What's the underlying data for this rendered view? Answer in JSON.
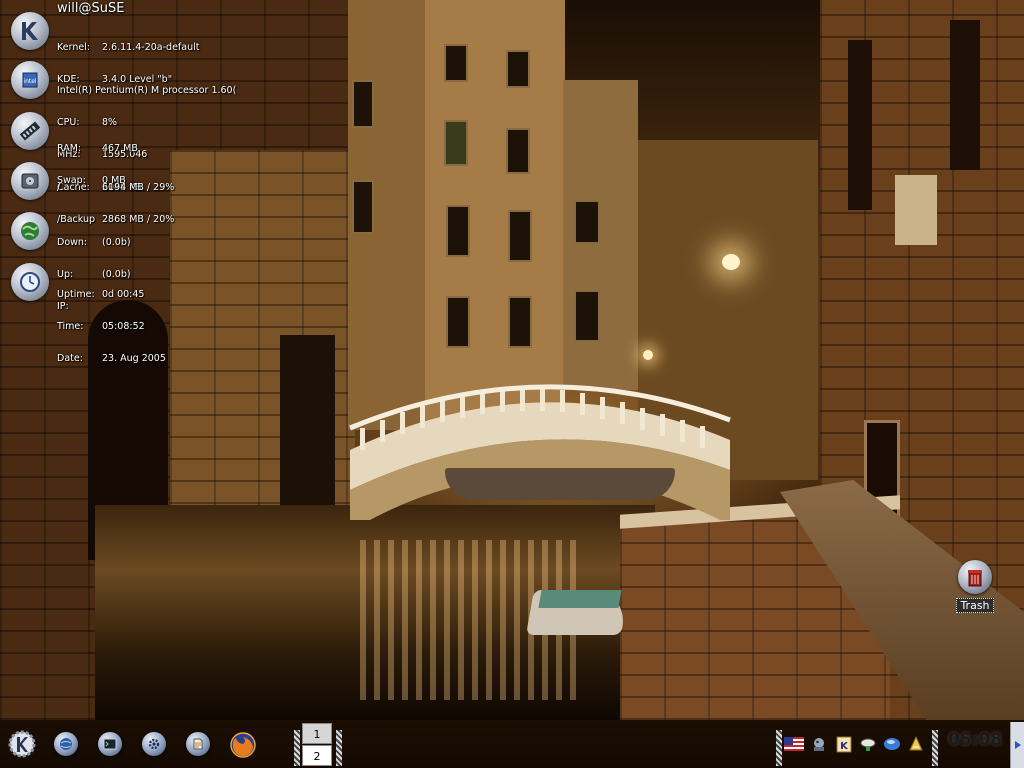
{
  "monitor": {
    "user_host": "will@SuSE",
    "system": [
      {
        "label": "Kernel:",
        "value": "2.6.11.4-20a-default"
      },
      {
        "label": "KDE:",
        "value": "3.4.0 Level \"b\""
      }
    ],
    "cpu": [
      {
        "label": "",
        "value": "Intel(R) Pentium(R) M processor 1.60("
      },
      {
        "label": "CPU:",
        "value": "8%"
      },
      {
        "label": "MHz:",
        "value": "1595.046"
      },
      {
        "label": "Cache:",
        "value": "2048 KB"
      }
    ],
    "memory": [
      {
        "label": "RAM:",
        "value": "467 MB"
      },
      {
        "label": "Swap:",
        "value": "0 MB"
      }
    ],
    "disk": [
      {
        "label": "/",
        "value": "6194 MB / 29%"
      },
      {
        "label": "/Backup",
        "value": "2868 MB / 20%"
      }
    ],
    "network": [
      {
        "label": "Down:",
        "value": "(0.0b)"
      },
      {
        "label": "Up:",
        "value": "(0.0b)"
      },
      {
        "label": "IP:",
        "value": ""
      }
    ],
    "time": [
      {
        "label": "Uptime:",
        "value": "0d 00:45"
      },
      {
        "label": "Time:",
        "value": "05:08:52"
      },
      {
        "label": "Date:",
        "value": "23. Aug 2005"
      }
    ]
  },
  "desktop_icons": {
    "trash_label": "Trash"
  },
  "pager": {
    "desktops": [
      "1",
      "2"
    ]
  },
  "clock": {
    "time": "05:08"
  },
  "colors": {
    "accent": "#c8903a"
  }
}
